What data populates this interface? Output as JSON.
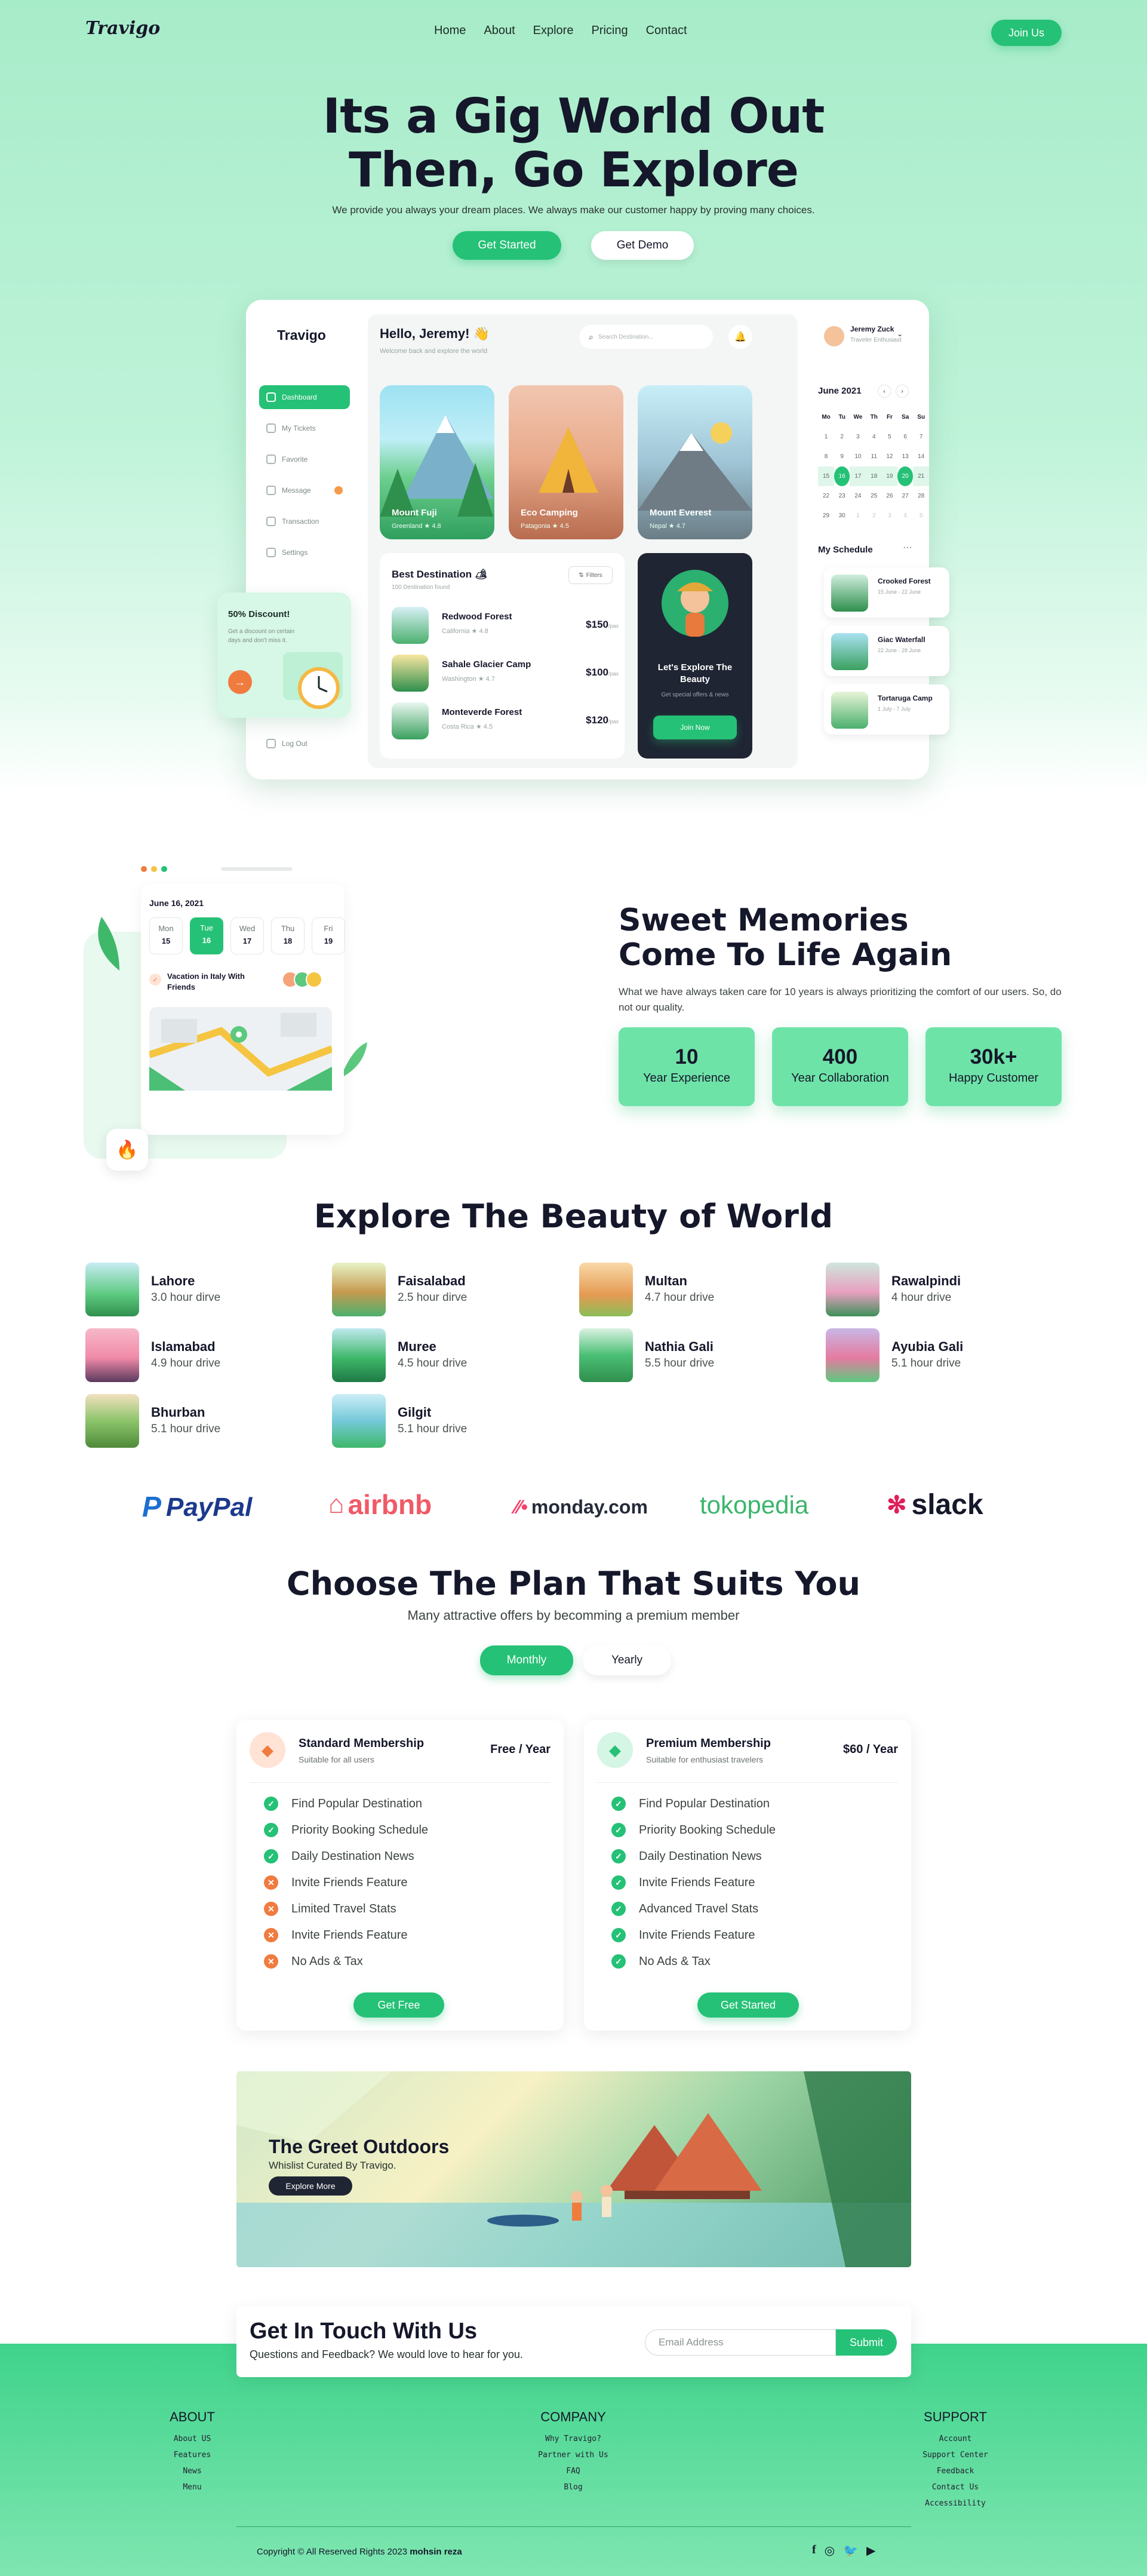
{
  "nav": {
    "logo": "Travigo",
    "links": [
      "Home",
      "About",
      "Explore",
      "Pricing",
      "Contact"
    ],
    "cta": "Join Us"
  },
  "hero": {
    "title_line1": "Its a Gig World Out",
    "title_line2": "Then, Go Explore",
    "subtitle": "We provide you always your dream places. We always make our customer happy by proving many choices.",
    "primary_btn": "Get Started",
    "secondary_btn": "Get Demo"
  },
  "dashboard": {
    "logo": "Travigo",
    "greeting": "Hello, Jeremy! 👋",
    "greeting_sub": "Welcome back and explore the world",
    "search_placeholder": "Search Destination...",
    "user_name": "Jeremy Zuck",
    "user_role": "Traveler Enthusiast",
    "sidebar": [
      "Dashboard",
      "My Tickets",
      "Favorite",
      "Message",
      "Transaction",
      "Settings"
    ],
    "logout": "Log Out",
    "discount_title": "50% Discount!",
    "discount_text": "Get a discount on certain days and don't miss it.",
    "cards": [
      {
        "name": "Mount Fuji",
        "loc": "Greenland",
        "rating": "4.8"
      },
      {
        "name": "Eco Camping",
        "loc": "Patagonia",
        "rating": "4.5"
      },
      {
        "name": "Mount Everest",
        "loc": "Nepal",
        "rating": "4.7"
      }
    ],
    "best_title": "Best Destination 🏕",
    "best_count": "100 Destination found",
    "filters": "Filters",
    "destinations": [
      {
        "name": "Redwood Forest",
        "loc": "California",
        "rating": "4.8",
        "price": "$150"
      },
      {
        "name": "Sahale Glacier Camp",
        "loc": "Washington",
        "rating": "4.7",
        "price": "$100"
      },
      {
        "name": "Monteverde Forest",
        "loc": "Costa Rica",
        "rating": "4.5",
        "price": "$120"
      }
    ],
    "price_unit": "/pax",
    "promo_title": "Let's Explore The Beauty",
    "promo_sub": "Get special offers & news",
    "promo_btn": "Join Now",
    "calendar_month": "June 2021",
    "calendar_days": [
      "Mo",
      "Tu",
      "We",
      "Th",
      "Fr",
      "Sa",
      "Su"
    ],
    "calendar_rows": [
      [
        "",
        "",
        "",
        "",
        "",
        "",
        ""
      ],
      [
        "1",
        "2",
        "3",
        "4",
        "5",
        "6",
        "7"
      ],
      [
        "8",
        "9",
        "10",
        "11",
        "12",
        "13",
        "14"
      ],
      [
        "15",
        "16",
        "17",
        "18",
        "19",
        "20",
        "21"
      ],
      [
        "22",
        "23",
        "24",
        "25",
        "26",
        "27",
        "28"
      ],
      [
        "29",
        "30",
        "1",
        "2",
        "3",
        "4",
        "5"
      ]
    ],
    "schedule_title": "My Schedule",
    "schedule": [
      {
        "name": "Crooked Forest",
        "date": "15 June - 22 June"
      },
      {
        "name": "Giac Waterfall",
        "date": "22 June - 28 June"
      },
      {
        "name": "Tortaruga Camp",
        "date": "1 July - 7 July"
      }
    ]
  },
  "memories": {
    "date": "June 16, 2021",
    "week": [
      {
        "d": "Mon",
        "n": "15"
      },
      {
        "d": "Tue",
        "n": "16"
      },
      {
        "d": "Wed",
        "n": "17"
      },
      {
        "d": "Thu",
        "n": "18"
      },
      {
        "d": "Fri",
        "n": "19"
      }
    ],
    "vacation": "Vacation in Italy With Friends",
    "title_line1": "Sweet Memories",
    "title_line2": "Come To Life Again",
    "text": "What we have always taken care for 10 years is always prioritizing the comfort of our users. So, do not our quality.",
    "stats": [
      {
        "n": "10",
        "l": "Year Experience"
      },
      {
        "n": "400",
        "l": "Year Collaboration"
      },
      {
        "n": "30k+",
        "l": "Happy Customer"
      }
    ]
  },
  "explore": {
    "title": "Explore The Beauty of World",
    "places": [
      {
        "name": "Lahore",
        "drive": "3.0 hour dirve"
      },
      {
        "name": "Faisalabad",
        "drive": "2.5 hour dirve"
      },
      {
        "name": "Multan",
        "drive": "4.7 hour drive"
      },
      {
        "name": "Rawalpindi",
        "drive": "4 hour drive"
      },
      {
        "name": "Islamabad",
        "drive": "4.9 hour drive"
      },
      {
        "name": "Muree",
        "drive": "4.5 hour drive"
      },
      {
        "name": "Nathia Gali",
        "drive": "5.5 hour drive"
      },
      {
        "name": "Ayubia Gali",
        "drive": "5.1 hour drive"
      },
      {
        "name": "Bhurban",
        "drive": "5.1 hour drive"
      },
      {
        "name": "Gilgit",
        "drive": "5.1 hour drive"
      }
    ]
  },
  "partners": [
    "PayPal",
    "airbnb",
    "monday.com",
    "tokopedia",
    "slack"
  ],
  "plans": {
    "title": "Choose The Plan That Suits You",
    "subtitle": "Many attractive offers by becomming a premium member",
    "toggle": [
      "Monthly",
      "Yearly"
    ],
    "standard": {
      "name": "Standard Membership",
      "sub": "Suitable for all users",
      "price": "Free / Year",
      "features": [
        "Find Popular Destination",
        "Priority Booking Schedule",
        "Daily Destination News",
        "Invite Friends Feature",
        "Limited Travel Stats",
        "Invite Friends Feature",
        "No Ads & Tax"
      ],
      "btn": "Get Free"
    },
    "premium": {
      "name": "Premium Membership",
      "sub": "Suitable for enthusiast travelers",
      "price": "$60 / Year",
      "features": [
        "Find Popular Destination",
        "Priority Booking Schedule",
        "Daily Destination News",
        "Invite Friends Feature",
        "Advanced Travel Stats",
        "Invite Friends Feature",
        "No Ads & Tax"
      ],
      "btn": "Get Started"
    }
  },
  "outdoors": {
    "title": "The Greet Outdoors",
    "sub": "Whislist Curated By Travigo.",
    "btn": "Explore More"
  },
  "contact": {
    "title": "Get In Touch With Us",
    "sub": "Questions and Feedback? We would love to hear for you.",
    "placeholder": "Email Address",
    "btn": "Submit"
  },
  "footer": {
    "about": {
      "title": "ABOUT",
      "items": [
        "About US",
        "Features",
        "News",
        "Menu"
      ]
    },
    "company": {
      "title": "COMPANY",
      "items": [
        "Why Travigo?",
        "Partner with Us",
        "FAQ",
        "Blog"
      ]
    },
    "support": {
      "title": "SUPPORT",
      "items": [
        "Account",
        "Support Center",
        "Feedback",
        "Contact Us",
        "Accessibility"
      ]
    },
    "copyright": "Copyright © All Reserved Rights 2023",
    "author": "mohsin reza"
  },
  "colors": {
    "accent": "#25c176",
    "mint": "#a7ecc9",
    "orange": "#f07b3f",
    "dark": "#15172a"
  }
}
